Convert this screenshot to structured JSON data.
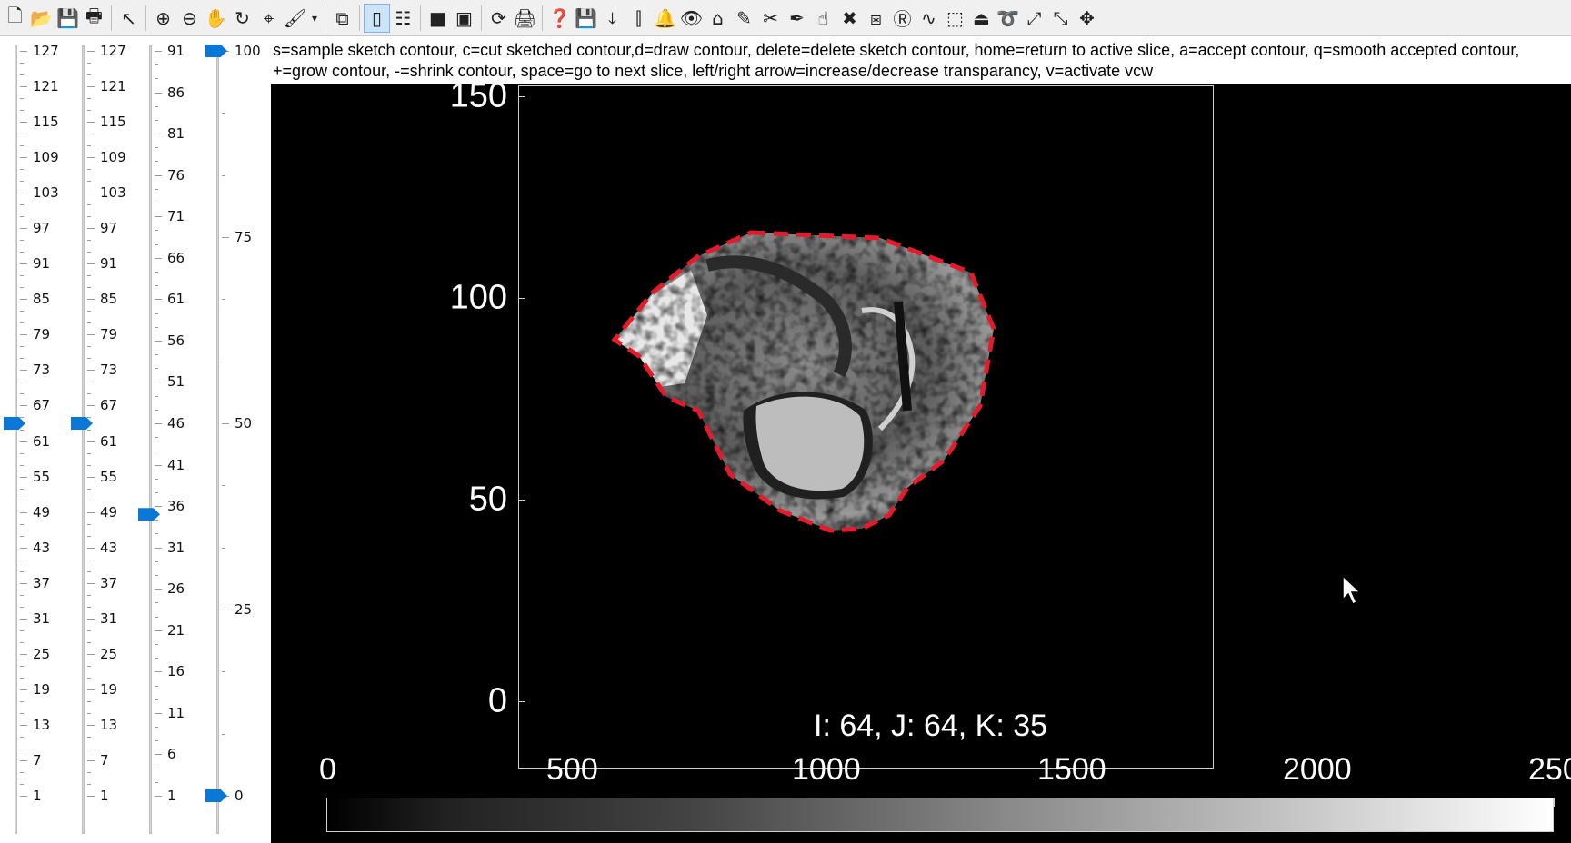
{
  "toolbar": {
    "buttons": [
      {
        "name": "new-file-icon",
        "glyph": "🗋"
      },
      {
        "name": "open-folder-icon",
        "glyph": "📂"
      },
      {
        "name": "save-icon",
        "glyph": "💾"
      },
      {
        "name": "print-icon",
        "glyph": "🖶"
      },
      {
        "name": "sep"
      },
      {
        "name": "pointer-icon",
        "glyph": "↖"
      },
      {
        "name": "sep"
      },
      {
        "name": "zoom-in-icon",
        "glyph": "⊕"
      },
      {
        "name": "zoom-out-icon",
        "glyph": "⊖"
      },
      {
        "name": "pan-hand-icon",
        "glyph": "✋"
      },
      {
        "name": "rotate-3d-icon",
        "glyph": "↻"
      },
      {
        "name": "data-cursor-icon",
        "glyph": "⌖"
      },
      {
        "name": "brush-icon",
        "glyph": "🖌"
      },
      {
        "name": "dropdown-arrow-icon",
        "glyph": "▾",
        "narrow": true
      },
      {
        "name": "sep"
      },
      {
        "name": "link-plot-icon",
        "glyph": "⧉"
      },
      {
        "name": "sep"
      },
      {
        "name": "colorbar-toggle-icon",
        "glyph": "▯",
        "active": true
      },
      {
        "name": "legend-toggle-icon",
        "glyph": "☷"
      },
      {
        "name": "sep"
      },
      {
        "name": "hide-plot-tools-icon",
        "glyph": "■"
      },
      {
        "name": "show-plot-tools-icon",
        "glyph": "▣"
      },
      {
        "name": "sep"
      },
      {
        "name": "refresh-icon",
        "glyph": "⟳"
      },
      {
        "name": "printer-red-icon",
        "glyph": "🖨"
      },
      {
        "name": "sep"
      },
      {
        "name": "help-icon",
        "glyph": "❓"
      },
      {
        "name": "save-disk-icon",
        "glyph": "💾"
      },
      {
        "name": "download-icon",
        "glyph": "⤓"
      },
      {
        "name": "vertical-line-icon",
        "glyph": "⫿"
      },
      {
        "name": "bell-icon",
        "glyph": "🔔"
      },
      {
        "name": "eye-icon",
        "glyph": "👁"
      },
      {
        "name": "home-icon",
        "glyph": "⌂"
      },
      {
        "name": "eyedropper-icon",
        "glyph": "✎"
      },
      {
        "name": "scissors-icon",
        "glyph": "✂"
      },
      {
        "name": "pen-icon",
        "glyph": "✒"
      },
      {
        "name": "hand-pointer-icon",
        "glyph": "☝"
      },
      {
        "name": "delete-x-icon",
        "glyph": "✖"
      },
      {
        "name": "crop-icon",
        "glyph": "⧆"
      },
      {
        "name": "r-icon",
        "glyph": "Ⓡ"
      },
      {
        "name": "smooth-contour-icon",
        "glyph": "∿"
      },
      {
        "name": "select-region-icon",
        "glyph": "⬚"
      },
      {
        "name": "iron-icon",
        "glyph": "⏏"
      },
      {
        "name": "lasso-icon",
        "glyph": "➰"
      },
      {
        "name": "expand-icon",
        "glyph": "⤢"
      },
      {
        "name": "shrink-icon",
        "glyph": "⤡"
      },
      {
        "name": "move-icon",
        "glyph": "✥"
      }
    ]
  },
  "sliders": [
    {
      "name": "slider-i",
      "labels": [
        "127",
        "121",
        "115",
        "109",
        "103",
        "97",
        "91",
        "85",
        "79",
        "73",
        "67",
        "61",
        "55",
        "49",
        "43",
        "37",
        "31",
        "25",
        "19",
        "13",
        "7",
        "1"
      ],
      "min": 1,
      "max": 127,
      "value": 64
    },
    {
      "name": "slider-j",
      "labels": [
        "127",
        "121",
        "115",
        "109",
        "103",
        "97",
        "91",
        "85",
        "79",
        "73",
        "67",
        "61",
        "55",
        "49",
        "43",
        "37",
        "31",
        "25",
        "19",
        "13",
        "7",
        "1"
      ],
      "min": 1,
      "max": 127,
      "value": 64
    },
    {
      "name": "slider-k",
      "labels": [
        "91",
        "86",
        "81",
        "76",
        "71",
        "66",
        "61",
        "56",
        "51",
        "46",
        "41",
        "36",
        "31",
        "26",
        "21",
        "16",
        "11",
        "6",
        "1"
      ],
      "min": 1,
      "max": 91,
      "value": 35
    },
    {
      "name": "slider-transparency",
      "labels": [
        "100",
        "75",
        "50",
        "25",
        "0"
      ],
      "min": 0,
      "max": 100,
      "value": 100,
      "value2": 0
    }
  ],
  "help_text": "s=sample sketch contour, c=cut sketched contour,d=draw contour, delete=delete sketch contour, home=return to active slice, a=accept contour, q=smooth accepted contour, +=grow contour, -=shrink contour, space=go to next slice, left/right arrow=increase/decrease transparancy, v=activate vcw",
  "viewer": {
    "y_tick_labels": [
      "150",
      "100",
      "50",
      "0"
    ],
    "coord_readout": "I: 64, J:  64, K: 35",
    "colorbar_labels": [
      "0",
      "500",
      "1000",
      "1500",
      "2000",
      "250"
    ],
    "contour_color": "#e41b2a"
  }
}
